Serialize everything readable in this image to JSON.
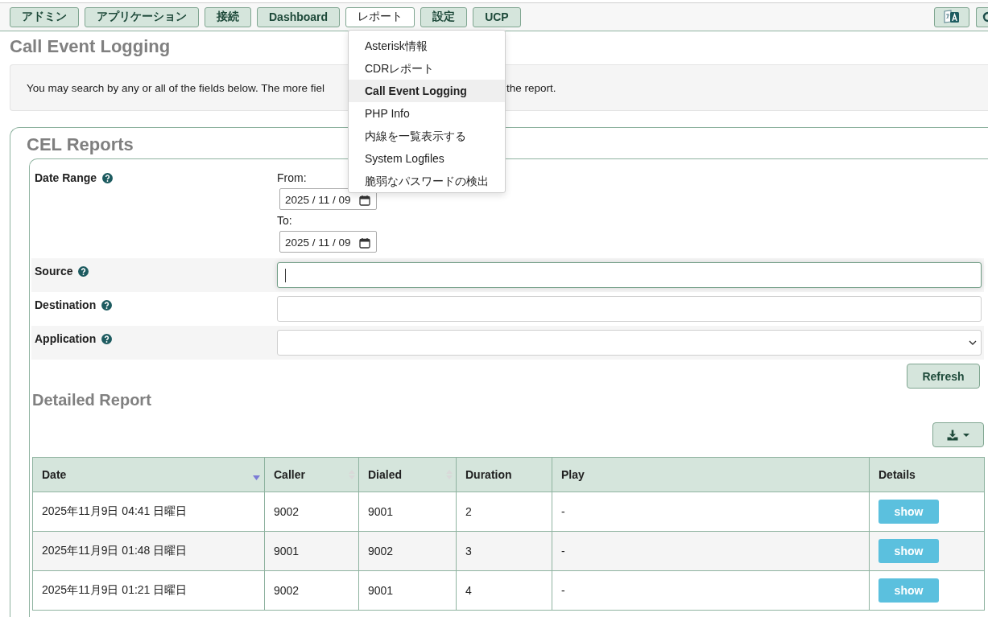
{
  "nav": {
    "tabs": [
      {
        "label": "アドミン",
        "selected": false
      },
      {
        "label": "アプリケーション",
        "selected": false
      },
      {
        "label": "接続",
        "selected": false
      },
      {
        "label": "Dashboard",
        "selected": false
      },
      {
        "label": "レポート",
        "selected": true
      },
      {
        "label": "設定",
        "selected": false
      },
      {
        "label": "UCP",
        "selected": false
      }
    ]
  },
  "menu": {
    "items": [
      {
        "label": "Asterisk情報",
        "selected": false
      },
      {
        "label": "CDRレポート",
        "selected": false
      },
      {
        "label": "Call Event Logging",
        "selected": true
      },
      {
        "label": "PHP Info",
        "selected": false
      },
      {
        "label": "内線を一覧表示する",
        "selected": false
      },
      {
        "label": "System Logfiles",
        "selected": false
      },
      {
        "label": "脆弱なパスワードの検出",
        "selected": false
      }
    ]
  },
  "page_title": "Call Event Logging",
  "info": {
    "texts": [
      "You may search by any or all of the fields below. The more fiel",
      "the report."
    ]
  },
  "panel": {
    "legend": "CEL Reports",
    "date_range": {
      "label": "Date Range",
      "from_label": "From:",
      "from_value": "2025 / 11 / 09",
      "to_label": "To:",
      "to_value": "2025 / 11 / 09"
    },
    "fields": [
      {
        "label": "Source",
        "kind": "text",
        "focused": true
      },
      {
        "label": "Destination",
        "kind": "text",
        "focused": false
      },
      {
        "label": "Application",
        "kind": "select",
        "focused": false
      }
    ],
    "refresh_button": "Refresh",
    "report_title": "Detailed Report",
    "table": {
      "columns": [
        {
          "label": "Date",
          "sortable": true,
          "sorted": true
        },
        {
          "label": "Caller",
          "sortable": true,
          "sorted": false
        },
        {
          "label": "Dialed",
          "sortable": true,
          "sorted": false
        },
        {
          "label": "Duration",
          "sortable": false,
          "sorted": false
        },
        {
          "label": "Play",
          "sortable": false,
          "sorted": false
        },
        {
          "label": "Details",
          "sortable": false,
          "sorted": false
        }
      ],
      "rows": [
        {
          "date": "2025年11月9日 04:41 日曜日",
          "caller": "9002",
          "dialed": "9001",
          "duration": "2",
          "play": "-",
          "details": "show"
        },
        {
          "date": "2025年11月9日 01:48 日曜日",
          "caller": "9001",
          "dialed": "9002",
          "duration": "3",
          "play": "-",
          "details": "show"
        },
        {
          "date": "2025年11月9日 01:21 日曜日",
          "caller": "9002",
          "dialed": "9001",
          "duration": "4",
          "play": "-",
          "details": "show"
        }
      ]
    }
  }
}
